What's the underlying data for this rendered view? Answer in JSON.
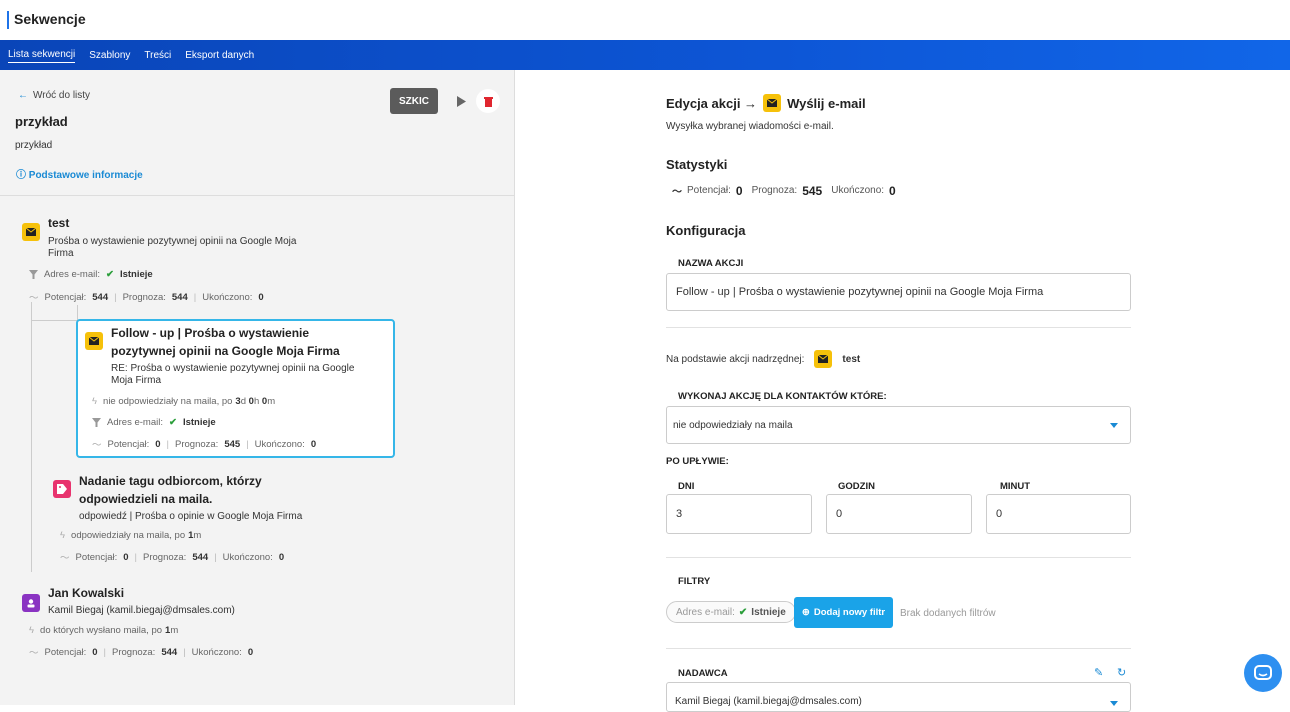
{
  "app": {
    "title": "Sekwencje"
  },
  "nav": {
    "tabs": [
      "Lista sekwencji",
      "Szablony",
      "Treści",
      "Eksport danych"
    ]
  },
  "left": {
    "back": "Wróć do listy",
    "name": "przykład",
    "description": "przykład",
    "basic_info": "Podstawowe informacje",
    "status_button": "SZKIC",
    "nodes": {
      "n1": {
        "title": "test",
        "subtitle1": "Prośba o wystawienie pozytywnej opinii na Google Moja",
        "subtitle2": "Firma",
        "filter_label": "Adres e-mail:",
        "filter_value": "Istnieje",
        "potential_label": "Potencjał:",
        "potential": "544",
        "forecast_label": "Prognoza:",
        "forecast": "544",
        "done_label": "Ukończono:",
        "done": "0"
      },
      "n2": {
        "title1": "Follow - up | Prośba o wystawienie",
        "title2": "pozytywnej opinii na Google Moja Firma",
        "subtitle1": "RE: Prośba o wystawienie pozytywnej opinii na Google",
        "subtitle2": "Moja Firma",
        "trigger_text": "nie odpowiedziały na maila, po",
        "trigger_d": "3",
        "trigger_h": "0",
        "trigger_m": "0",
        "filter_label": "Adres e-mail:",
        "filter_value": "Istnieje",
        "potential_label": "Potencjał:",
        "potential": "0",
        "forecast_label": "Prognoza:",
        "forecast": "545",
        "done_label": "Ukończono:",
        "done": "0"
      },
      "n3": {
        "title1": "Nadanie tagu odbiorcom, którzy",
        "title2": "odpowiedzieli na maila.",
        "subtitle": "odpowiedź | Prośba o opinie w Google Moja Firma",
        "trigger_text": "odpowiedziały na maila, po",
        "trigger_m": "1",
        "potential_label": "Potencjał:",
        "potential": "0",
        "forecast_label": "Prognoza:",
        "forecast": "544",
        "done_label": "Ukończono:",
        "done": "0"
      },
      "n4": {
        "title": "Jan Kowalski",
        "subtitle": "Kamil Biegaj (kamil.biegaj@dmsales.com)",
        "trigger_text": "do których wysłano maila, po",
        "trigger_m": "1",
        "potential_label": "Potencjał:",
        "potential": "0",
        "forecast_label": "Prognoza:",
        "forecast": "544",
        "done_label": "Ukończono:",
        "done": "0"
      }
    }
  },
  "right": {
    "heading_prefix": "Edycja akcji →",
    "heading_action": "Wyślij e-mail",
    "description": "Wysyłka wybranej wiadomości e-mail.",
    "stats_title": "Statystyki",
    "stats": {
      "potential_label": "Potencjał:",
      "potential": "0",
      "forecast_label": "Prognoza:",
      "forecast": "545",
      "done_label": "Ukończono:",
      "done": "0"
    },
    "config_title": "Konfiguracja",
    "action_name_label": "NAZWA AKCJI",
    "action_name_value": "Follow - up | Prośba o wystawienie pozytywnej opinii na Google Moja Firma",
    "parent_label": "Na podstawie akcji nadrzędnej:",
    "parent_value": "test",
    "condition_label": "WYKONAJ AKCJĘ DLA KONTAKTÓW KTÓRE:",
    "condition_value": "nie odpowiedziały na maila",
    "after_label": "PO UPŁYWIE:",
    "days_label": "DNI",
    "days_value": "3",
    "hours_label": "GODZIN",
    "hours_value": "0",
    "minutes_label": "MINUT",
    "minutes_value": "0",
    "filters_title": "FILTRY",
    "filter_chip_label": "Adres e-mail:",
    "filter_chip_value": "Istnieje",
    "add_filter": "Dodaj nowy filtr",
    "no_filters": "Brak dodanych filtrów",
    "sender_label": "NADAWCA",
    "sender_value": "Kamil Biegaj (kamil.biegaj@dmsales.com)"
  },
  "colors": {
    "nav": "#0d56d6",
    "accent": "#1a8ad4",
    "email_icon": "#f6c10a",
    "tag_icon": "#e8336e",
    "contact_icon": "#8a33c2",
    "active_card_border": "#35b6e8"
  },
  "icons": [
    "back-arrow-icon",
    "play-icon",
    "trash-icon",
    "info-icon",
    "envelope-icon",
    "filter-icon",
    "check-icon",
    "trend-icon",
    "bolt-icon",
    "tag-icon",
    "person-icon",
    "pencil-icon",
    "refresh-icon",
    "chat-icon"
  ]
}
